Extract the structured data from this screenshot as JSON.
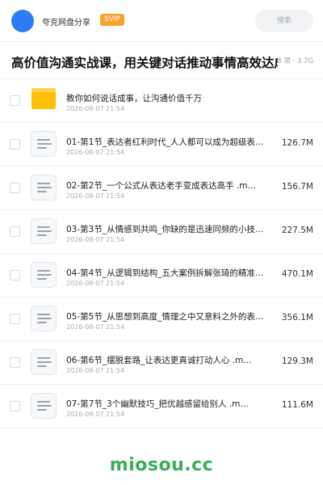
{
  "header": {
    "share_title": "夸克网盘分享",
    "badge": "SVIP",
    "search_placeholder": "搜索",
    "accent_color": "#2f7bf5",
    "badge_color": "#f7a32a"
  },
  "folder": {
    "title": "高价值沟通实战课，用关键对话推动事情高效达成",
    "meta": "8 项 · 3.7G"
  },
  "files": [
    {
      "name": "教你如何说话成事，让沟通价值千万",
      "date": "2026-08-07 21:54",
      "size": "",
      "icon": "folder-icon"
    },
    {
      "name": "01-第1节_表达者红利时代_人人都可以成为超级表…",
      "date": "2026-08-07 21:54",
      "size": "126.7M",
      "icon": "document-icon"
    },
    {
      "name": "02-第2节_一个公式从表达老手变成表达高手 .m…",
      "date": "2026-08-07 21:54",
      "size": "156.7M",
      "icon": "document-icon"
    },
    {
      "name": "03-第3节_从情感到共鸣_你缺的是迅速同频的小技…",
      "date": "2026-08-07 21:54",
      "size": "227.5M",
      "icon": "document-icon"
    },
    {
      "name": "04-第4节_从逻辑到结构_五大案例拆解张琦的精准…",
      "date": "2026-08-07 21:54",
      "size": "470.1M",
      "icon": "document-icon"
    },
    {
      "name": "05-第5节_从思想到高度_情理之中又意料之外的表…",
      "date": "2026-08-07 21:54",
      "size": "356.1M",
      "icon": "document-icon"
    },
    {
      "name": "06-第6节_摆脱套路_让表达更真诚打动人心 .m…",
      "date": "2026-08-07 21:54",
      "size": "129.3M",
      "icon": "document-icon"
    },
    {
      "name": "07-第7节_3个幽默技巧_把优越感留给别人 .m…",
      "date": "2026-08-07 21:54",
      "size": "111.6M",
      "icon": "document-icon"
    }
  ],
  "watermark": {
    "text": "miosou.cc",
    "color": "#3aae58"
  }
}
